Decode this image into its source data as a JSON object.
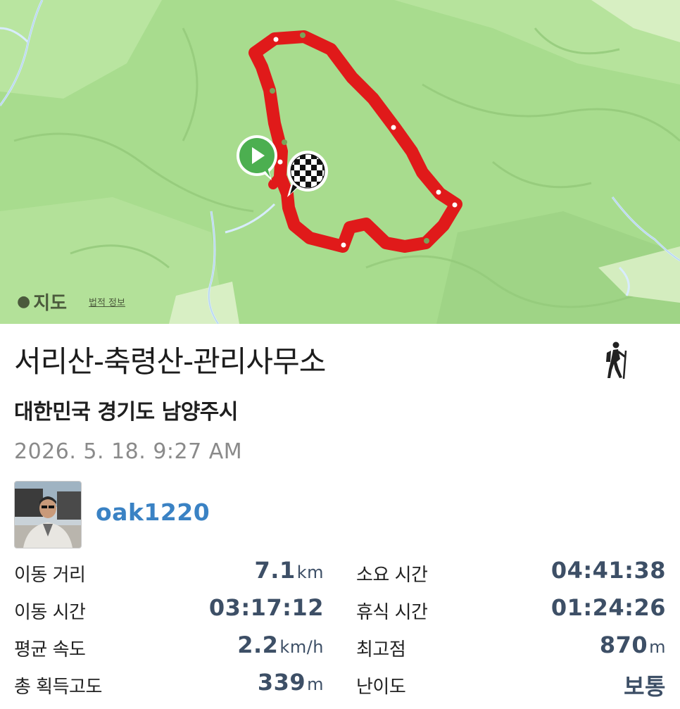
{
  "map": {
    "brand_label": "지도",
    "legal_label": "법적 정보",
    "colors": {
      "land": "#a6da8c",
      "route": "#e11c1c",
      "start_marker": "#4caf50"
    },
    "start_icon": "play-icon",
    "end_icon": "checkered-flag-icon"
  },
  "course": {
    "title": "서리산-축령산-관리사무소",
    "activity_icon": "hiker-icon",
    "region": "대한민국 경기도 남양주시",
    "datetime": "2026. 5. 18. 9:27 AM"
  },
  "user": {
    "name": "oak1220"
  },
  "stats": {
    "distance": {
      "label": "이동 거리",
      "value": "7.1",
      "unit": "km"
    },
    "total_time": {
      "label": "소요 시간",
      "value": "04:41:38"
    },
    "moving_time": {
      "label": "이동 시간",
      "value": "03:17:12"
    },
    "rest_time": {
      "label": "휴식 시간",
      "value": "01:24:26"
    },
    "avg_speed": {
      "label": "평균 속도",
      "value": "2.2",
      "unit": "km/h"
    },
    "max_elevation": {
      "label": "최고점",
      "value": "870",
      "unit": "m"
    },
    "elevation_gain": {
      "label": "총 획득고도",
      "value": "339",
      "unit": "m"
    },
    "difficulty": {
      "label": "난이도",
      "value": "보통"
    }
  }
}
